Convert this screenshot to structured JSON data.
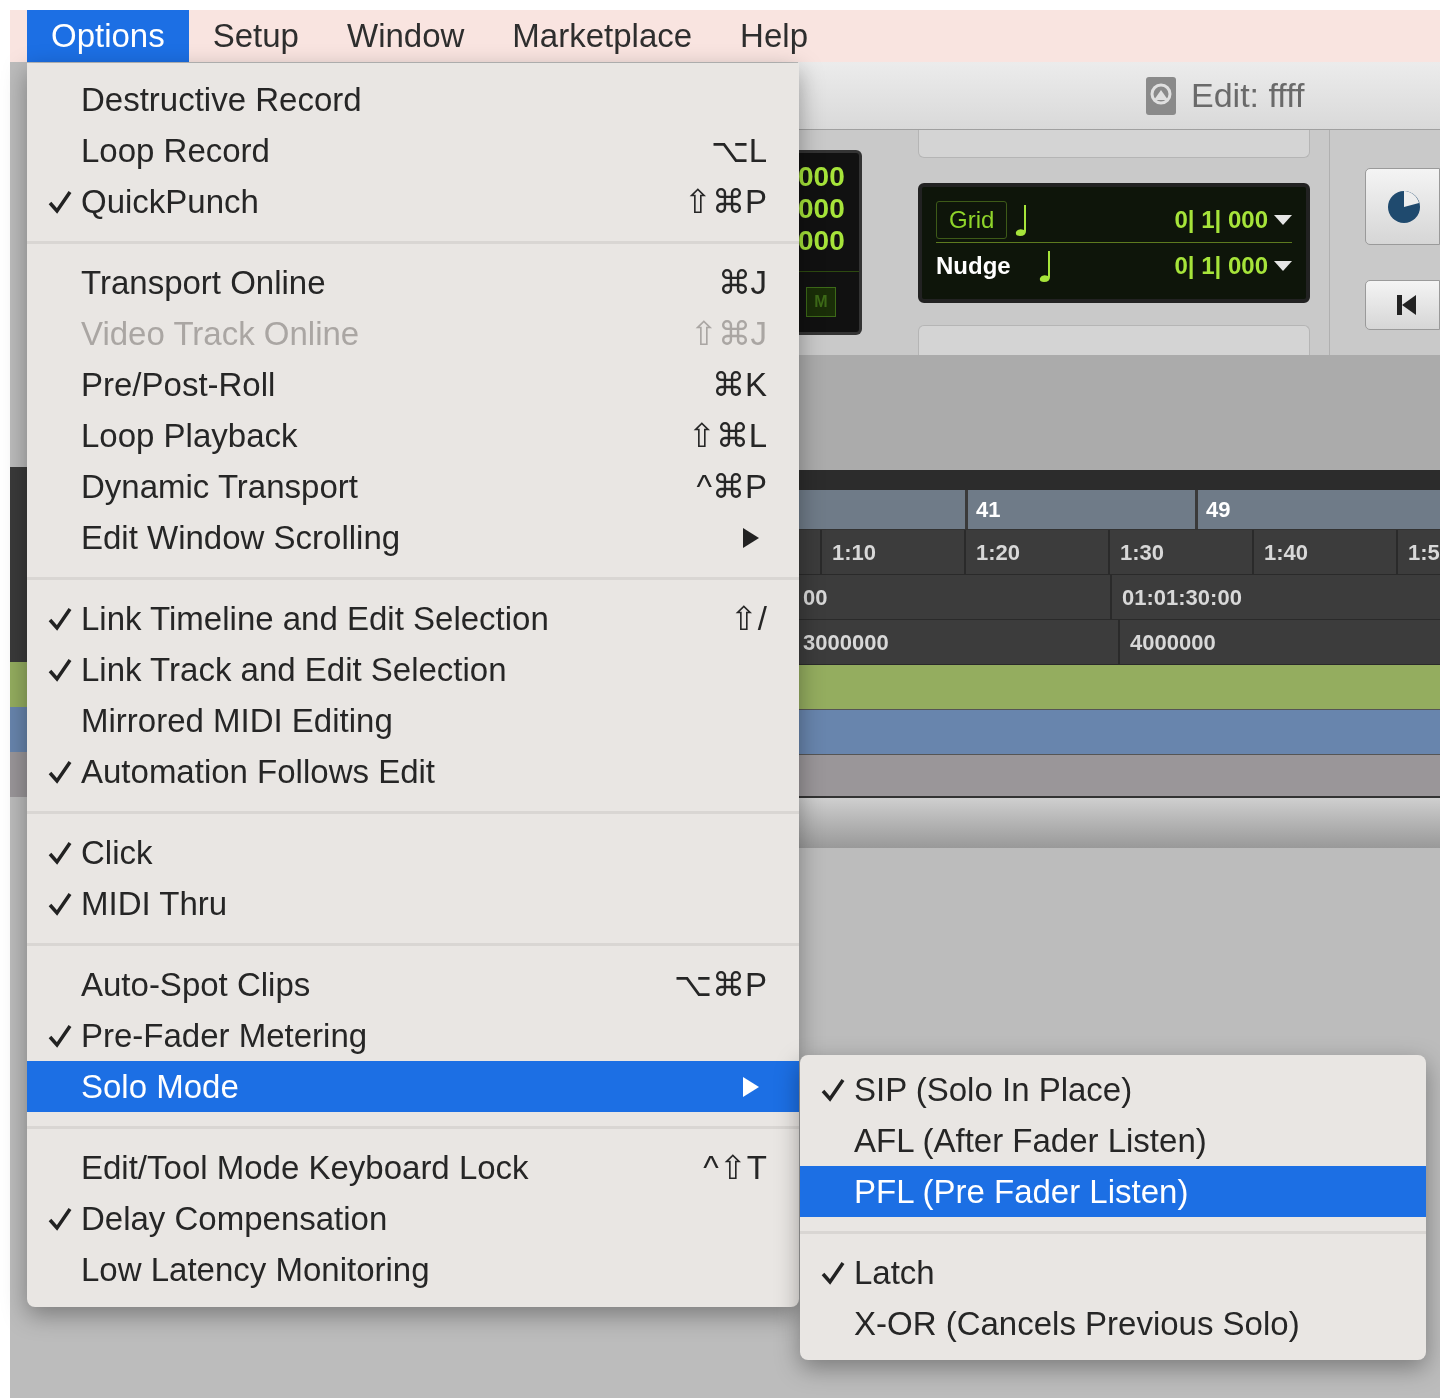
{
  "menu_bar": [
    {
      "label": "Options",
      "selected": true
    },
    {
      "label": "Setup",
      "selected": false
    },
    {
      "label": "Window",
      "selected": false
    },
    {
      "label": "Marketplace",
      "selected": false
    },
    {
      "label": "Help",
      "selected": false
    }
  ],
  "options_menu": [
    {
      "kind": "item",
      "label": "Destructive Record",
      "checked": false,
      "disabled": false,
      "selected": false
    },
    {
      "kind": "item",
      "label": "Loop Record",
      "shortcut": "⌥L",
      "checked": false,
      "disabled": false,
      "selected": false
    },
    {
      "kind": "item",
      "label": "QuickPunch",
      "shortcut": "⇧⌘P",
      "checked": true,
      "disabled": false,
      "selected": false
    },
    {
      "kind": "separator"
    },
    {
      "kind": "item",
      "label": "Transport Online",
      "shortcut": "⌘J",
      "checked": false,
      "disabled": false,
      "selected": false
    },
    {
      "kind": "item",
      "label": "Video Track Online",
      "shortcut": "⇧⌘J",
      "checked": false,
      "disabled": true,
      "selected": false
    },
    {
      "kind": "item",
      "label": "Pre/Post-Roll",
      "shortcut": "⌘K",
      "checked": false,
      "disabled": false,
      "selected": false
    },
    {
      "kind": "item",
      "label": "Loop Playback",
      "shortcut": "⇧⌘L",
      "checked": false,
      "disabled": false,
      "selected": false
    },
    {
      "kind": "item",
      "label": "Dynamic Transport",
      "shortcut": "^⌘P",
      "checked": false,
      "disabled": false,
      "selected": false
    },
    {
      "kind": "submenu",
      "label": "Edit Window Scrolling",
      "checked": false,
      "disabled": false,
      "selected": false
    },
    {
      "kind": "separator"
    },
    {
      "kind": "item",
      "label": "Link Timeline and Edit Selection",
      "shortcut": "⇧/",
      "checked": true,
      "disabled": false,
      "selected": false
    },
    {
      "kind": "item",
      "label": "Link Track and Edit Selection",
      "checked": true,
      "disabled": false,
      "selected": false
    },
    {
      "kind": "item",
      "label": "Mirrored MIDI Editing",
      "checked": false,
      "disabled": false,
      "selected": false
    },
    {
      "kind": "item",
      "label": "Automation Follows Edit",
      "checked": true,
      "disabled": false,
      "selected": false
    },
    {
      "kind": "separator"
    },
    {
      "kind": "item",
      "label": "Click",
      "checked": true,
      "disabled": false,
      "selected": false
    },
    {
      "kind": "item",
      "label": "MIDI Thru",
      "checked": true,
      "disabled": false,
      "selected": false
    },
    {
      "kind": "separator"
    },
    {
      "kind": "item",
      "label": "Auto-Spot Clips",
      "shortcut": "⌥⌘P",
      "checked": false,
      "disabled": false,
      "selected": false
    },
    {
      "kind": "item",
      "label": "Pre-Fader Metering",
      "checked": true,
      "disabled": false,
      "selected": false
    },
    {
      "kind": "submenu",
      "label": "Solo Mode",
      "checked": false,
      "disabled": false,
      "selected": true
    },
    {
      "kind": "separator"
    },
    {
      "kind": "item",
      "label": "Edit/Tool Mode Keyboard Lock",
      "shortcut": "^⇧T",
      "checked": false,
      "disabled": false,
      "selected": false
    },
    {
      "kind": "item",
      "label": "Delay Compensation",
      "checked": true,
      "disabled": false,
      "selected": false
    },
    {
      "kind": "item",
      "label": "Low Latency Monitoring",
      "checked": false,
      "disabled": false,
      "selected": false
    }
  ],
  "solo_mode_submenu": [
    {
      "kind": "item",
      "label": "SIP (Solo In Place)",
      "checked": true,
      "disabled": false,
      "selected": false
    },
    {
      "kind": "item",
      "label": "AFL (After Fader Listen)",
      "checked": false,
      "disabled": false,
      "selected": false
    },
    {
      "kind": "item",
      "label": "PFL (Pre Fader Listen)",
      "checked": false,
      "disabled": false,
      "selected": true
    },
    {
      "kind": "separator"
    },
    {
      "kind": "item",
      "label": "Latch",
      "checked": true,
      "disabled": false,
      "selected": false
    },
    {
      "kind": "item",
      "label": "X-OR (Cancels Previous Solo)",
      "checked": false,
      "disabled": false,
      "selected": false
    }
  ],
  "edit_window": {
    "title": "Edit: ffff",
    "counter": {
      "values": [
        "000",
        "000",
        "000"
      ],
      "badge": "M"
    },
    "grid": {
      "label": "Grid",
      "value": "0| 1| 000"
    },
    "nudge": {
      "label": "Nudge",
      "value": "0| 1| 000"
    },
    "bars_ruler": [
      "41",
      "49"
    ],
    "min_secs_ruler": [
      "1:10",
      "1:20",
      "1:30",
      "1:40",
      "1:5"
    ],
    "timecode_ruler": [
      "00",
      "01:01:30:00"
    ],
    "samples_ruler": [
      "3000000",
      "4000000"
    ]
  }
}
